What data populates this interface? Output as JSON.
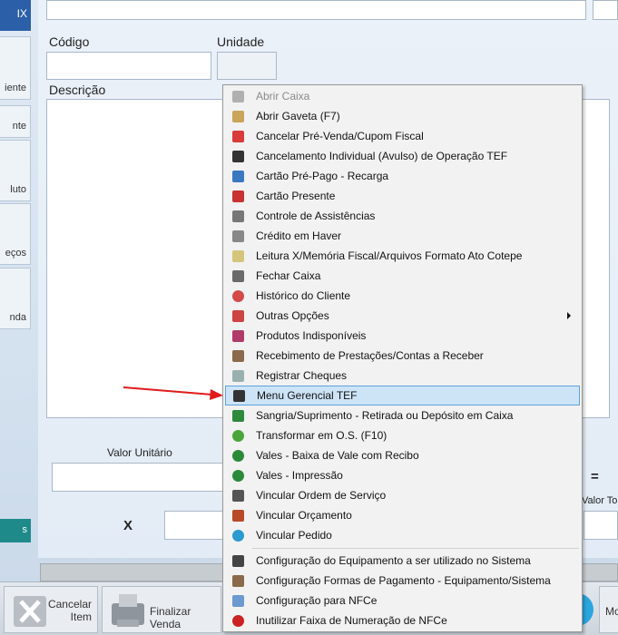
{
  "sidebar": {
    "top_label": "IX",
    "items": [
      {
        "label": "iente"
      },
      {
        "label": "nte"
      },
      {
        "label": "luto"
      },
      {
        "label": "eços"
      },
      {
        "label": "nda"
      }
    ],
    "teal_label": "s"
  },
  "form": {
    "codigo_label": "Código",
    "unidade_label": "Unidade",
    "descricao_label": "Descrição",
    "valor_unitario_label": "Valor Unitário",
    "multiply_symbol": "X",
    "equals_symbol": "=",
    "valor_total_label": "Valor To"
  },
  "toolbar": {
    "cancelar_item_label_1": "Cancelar",
    "cancelar_item_label_2": "Item",
    "finalizar_venda_label": "Finalizar Venda",
    "right_label": "Mo"
  },
  "menu": {
    "items": [
      {
        "label": "Abrir Caixa",
        "icon": "cash-register-icon",
        "disabled": true
      },
      {
        "label": "Abrir Gaveta (F7)",
        "icon": "drawer-icon"
      },
      {
        "label": "Cancelar Pré-Venda/Cupom Fiscal",
        "icon": "cancel-red-icon"
      },
      {
        "label": "Cancelamento Individual (Avulso) de Operação TEF",
        "icon": "card-reader-icon"
      },
      {
        "label": "Cartão Pré-Pago - Recarga",
        "icon": "prepaid-card-icon"
      },
      {
        "label": "Cartão Presente",
        "icon": "gift-card-icon"
      },
      {
        "label": "Controle de Assistências",
        "icon": "assistance-icon"
      },
      {
        "label": "Crédito em Haver",
        "icon": "credit-icon"
      },
      {
        "label": "Leitura X/Memória Fiscal/Arquivos Formato Ato Cotepe",
        "icon": "fiscal-reading-icon"
      },
      {
        "label": "Fechar Caixa",
        "icon": "close-register-icon"
      },
      {
        "label": "Histórico do Cliente",
        "icon": "client-history-icon"
      },
      {
        "label": "Outras Opções",
        "icon": "other-options-icon",
        "submenu": true
      },
      {
        "label": "Produtos Indisponíveis",
        "icon": "unavailable-products-icon"
      },
      {
        "label": "Recebimento de Prestações/Contas a Receber",
        "icon": "receivables-icon"
      },
      {
        "label": "Registrar Cheques",
        "icon": "checks-icon"
      },
      {
        "label": "Menu Gerencial TEF",
        "icon": "tef-menu-icon",
        "highlighted": true
      },
      {
        "label": "Sangria/Suprimento - Retirada ou Depósito em Caixa",
        "icon": "cash-withdrawal-icon"
      },
      {
        "label": "Transformar em O.S. (F10)",
        "icon": "transform-os-icon"
      },
      {
        "label": "Vales - Baixa de Vale com Recibo",
        "icon": "voucher-receipt-icon"
      },
      {
        "label": "Vales - Impressão",
        "icon": "voucher-print-icon"
      },
      {
        "label": "Vincular Ordem de Serviço",
        "icon": "link-service-order-icon"
      },
      {
        "label": "Vincular Orçamento",
        "icon": "link-budget-icon"
      },
      {
        "label": "Vincular Pedido",
        "icon": "link-order-icon"
      },
      {
        "label": "Configuração do Equipamento a ser utilizado no Sistema",
        "icon": "equipment-config-icon"
      },
      {
        "label": "Configuração Formas de Pagamento - Equipamento/Sistema",
        "icon": "payment-config-icon"
      },
      {
        "label": "Configuração para NFCe",
        "icon": "nfce-config-icon"
      },
      {
        "label": "Inutilizar Faixa de Numeração de NFCe",
        "icon": "nfce-void-icon"
      }
    ]
  },
  "colors": {
    "menu_highlight_bg": "#cde4f7",
    "menu_highlight_border": "#5fa2dd",
    "arrow": "#e11b1b",
    "sidebar_top": "#2b5fa8",
    "sidebar_teal": "#1e8a8a"
  }
}
